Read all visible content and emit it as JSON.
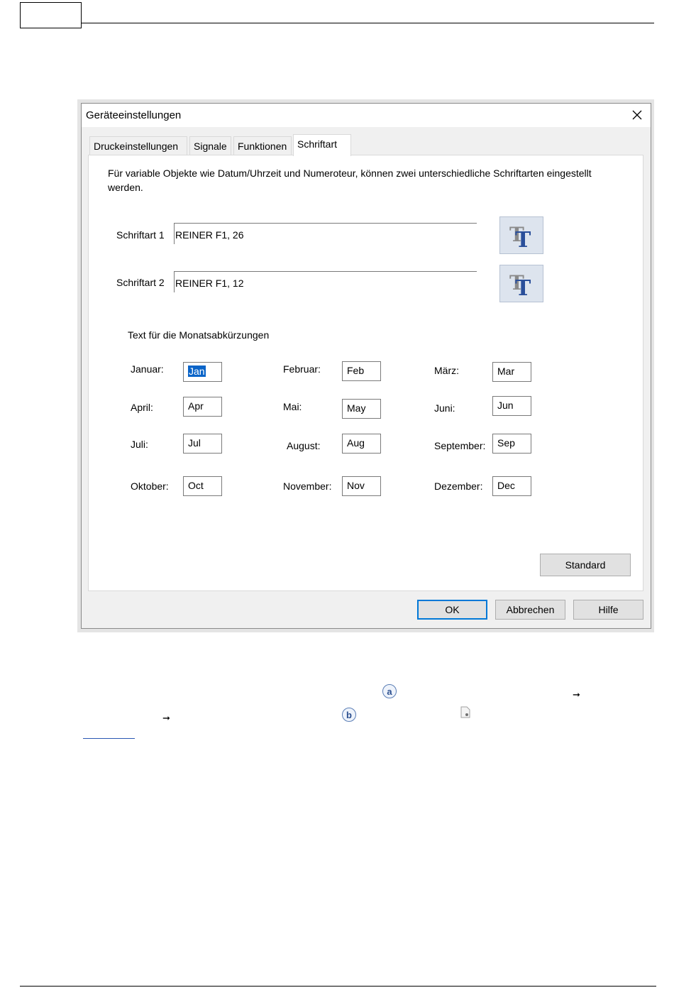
{
  "dialog": {
    "title": "Geräteeinstellungen",
    "tabs": [
      "Druckeinstellungen",
      "Signale",
      "Funktionen",
      "Schriftart"
    ],
    "active_tab": "Schriftart",
    "description": "Für variable Objekte wie Datum/Uhrzeit und Numeroteur, können zwei unterschiedliche Schriftarten eingestellt werden.",
    "fonts": [
      {
        "label": "Schriftart  1",
        "value": "REINER F1, 26"
      },
      {
        "label": "Schriftart  2",
        "value": "REINER F1, 12"
      }
    ],
    "month_heading": "Text für die Monatsabkürzungen",
    "months": [
      {
        "label": "Januar:",
        "value": "Jan"
      },
      {
        "label": "Februar:",
        "value": "Feb"
      },
      {
        "label": "März:",
        "value": "Mar"
      },
      {
        "label": "April:",
        "value": "Apr"
      },
      {
        "label": "Mai:",
        "value": "May"
      },
      {
        "label": "Juni:",
        "value": "Jun"
      },
      {
        "label": "Juli:",
        "value": "Jul"
      },
      {
        "label": "August:",
        "value": "Aug"
      },
      {
        "label": "September:",
        "value": "Sep"
      },
      {
        "label": "Oktober:",
        "value": "Oct"
      },
      {
        "label": "November:",
        "value": "Nov"
      },
      {
        "label": "Dezember:",
        "value": "Dec"
      }
    ],
    "standard_label": "Standard",
    "ok_label": "OK",
    "cancel_label": "Abbrechen",
    "help_label": "Hilfe"
  },
  "markers": {
    "a": "a",
    "b": "b"
  },
  "icons": {
    "font_button": "font-picker-icon",
    "close": "close-icon",
    "arrow": "arrow-right-icon",
    "document": "document-icon"
  },
  "colors": {
    "accent": "#0078d7",
    "selection": "#0a64c8",
    "font_icon": "#2a4f9a"
  }
}
